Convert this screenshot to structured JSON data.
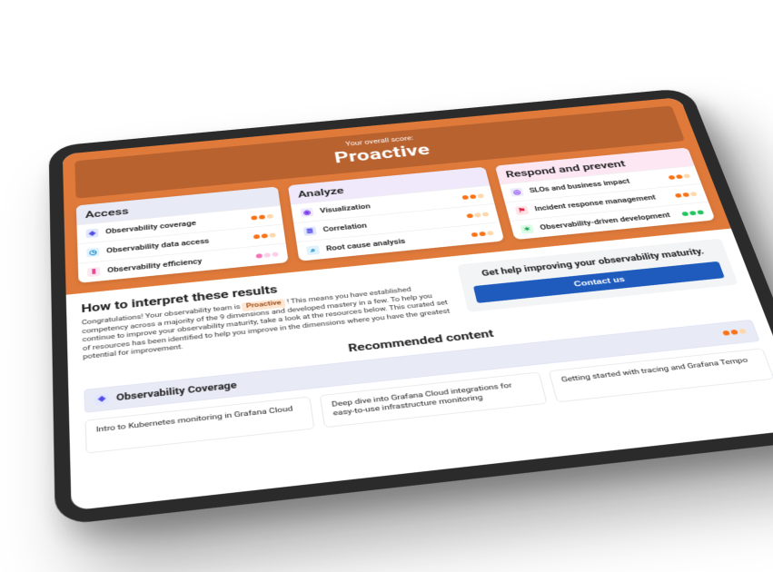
{
  "hero": {
    "score_label": "Your overall score:",
    "score_value": "Proactive"
  },
  "columns": [
    {
      "title": "Access",
      "head_class": "head-blue",
      "items": [
        {
          "icon": "ic-ly",
          "glyph": "◈",
          "label": "Observability coverage",
          "dots": [
            "d-o",
            "d-o",
            "d-of"
          ]
        },
        {
          "icon": "ic-cl",
          "glyph": "◷",
          "label": "Observability data access",
          "dots": [
            "d-o",
            "d-o",
            "d-of"
          ]
        },
        {
          "icon": "ic-bar",
          "glyph": "⫴",
          "label": "Observability efficiency",
          "dots": [
            "d-p",
            "d-pf",
            "d-pf"
          ]
        }
      ]
    },
    {
      "title": "Analyze",
      "head_class": "head-lilac",
      "items": [
        {
          "icon": "ic-eye",
          "glyph": "◉",
          "label": "Visualization",
          "dots": [
            "d-o",
            "d-o",
            "d-of"
          ]
        },
        {
          "icon": "ic-lin",
          "glyph": "≣",
          "label": "Correlation",
          "dots": [
            "d-o",
            "d-of",
            "d-of"
          ]
        },
        {
          "icon": "ic-mag",
          "glyph": "⌕",
          "label": "Root cause analysis",
          "dots": [
            "d-o",
            "d-o",
            "d-of"
          ]
        }
      ]
    },
    {
      "title": "Respond and prevent",
      "head_class": "head-pink",
      "items": [
        {
          "icon": "ic-tgt",
          "glyph": "◎",
          "label": "SLOs and business impact",
          "dots": [
            "d-o",
            "d-o",
            "d-of"
          ]
        },
        {
          "icon": "ic-wrn",
          "glyph": "⚑",
          "label": "Incident response management",
          "dots": [
            "d-o",
            "d-o",
            "d-of"
          ]
        },
        {
          "icon": "ic-grn",
          "glyph": "✶",
          "label": "Observability-driven development",
          "dots": [
            "d-g",
            "d-g",
            "d-g"
          ]
        }
      ]
    }
  ],
  "interpret": {
    "heading": "How to interpret these results",
    "pre": "Congratulations! Your observability team is ",
    "tag": "Proactive",
    "post": " ! This means you have established competency across a majority of the 9 dimensions and developed mastery in a few. To help you continue to improve your observability maturity, take a look at the resources below. This curated set of resources has been identified to help you improve in the dimensions where you have the greatest potential for improvement."
  },
  "help": {
    "title": "Get help improving your observability maturity.",
    "button": "Contact us"
  },
  "recommended": {
    "heading": "Recommended content",
    "section": {
      "icon": "ic-ly",
      "glyph": "◈",
      "label": "Observability Coverage",
      "dots": [
        "d-o",
        "d-o",
        "d-of"
      ]
    },
    "cards": [
      "Intro to Kubernetes monitoring in Grafana Cloud",
      "Deep dive into Grafana Cloud integrations for easy-to-use infrastructure monitoring",
      "Getting started with tracing and Grafana Tempo"
    ]
  }
}
